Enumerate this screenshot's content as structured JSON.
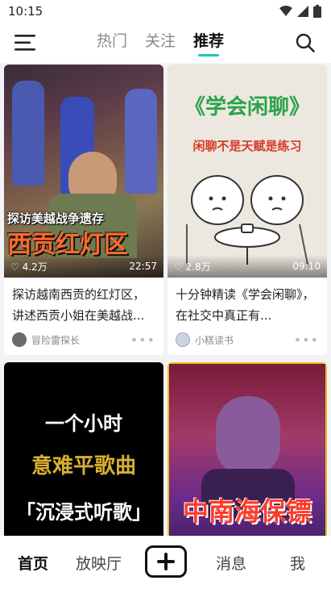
{
  "status": {
    "time": "10:15"
  },
  "tabs": [
    {
      "label": "热门"
    },
    {
      "label": "关注"
    },
    {
      "label": "推荐"
    }
  ],
  "cards": [
    {
      "cover_top": "探访美越战争遗存",
      "cover_big": "西贡红灯区",
      "likes": "4.2万",
      "duration": "22:57",
      "title": "探访越南西贡的红灯区，讲述西贡小姐在美越战...",
      "author": "冒险雷探长"
    },
    {
      "cover_top": "《学会闲聊》",
      "cover_sub": "闲聊不是天赋是练习",
      "likes": "2.8万",
      "duration": "09:10",
      "title": "十分钟精读《学会闲聊》，在社交中真正有...",
      "author": "小糕读书"
    },
    {
      "cover_line1": "一个小时",
      "cover_line2": "意难平歌曲",
      "cover_line3": "「沉浸式听歌」"
    },
    {
      "cover_big": "中南海保镖"
    }
  ],
  "nav": [
    {
      "label": "首页"
    },
    {
      "label": "放映厅"
    },
    {
      "label": "消息"
    },
    {
      "label": "我"
    }
  ],
  "colors": {
    "accent": "#1fc7b6"
  },
  "icons": {
    "menu": "menu-icon",
    "search": "search-icon",
    "add": "plus-icon",
    "more": "more-dots-icon",
    "like": "heart-icon"
  }
}
